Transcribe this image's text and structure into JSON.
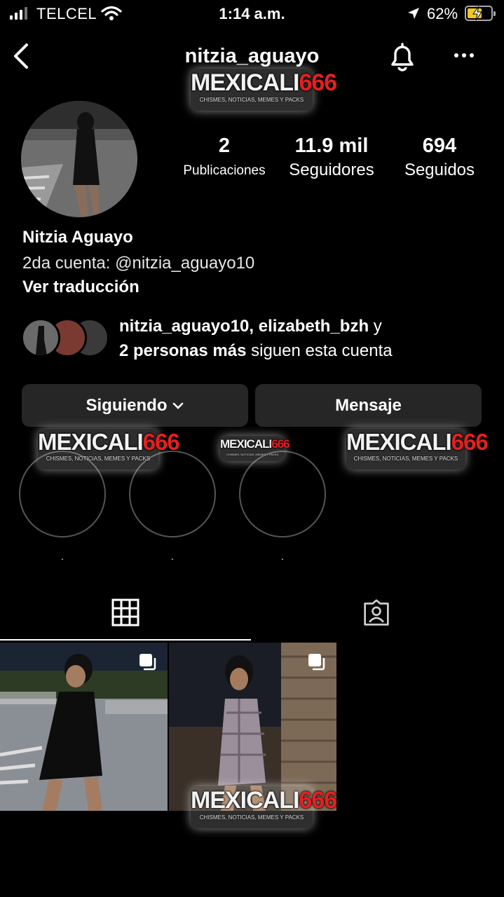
{
  "status_bar": {
    "carrier": "TELCEL",
    "time": "1:14 a.m.",
    "battery_pct": "62%",
    "battery_level": 0.62
  },
  "header": {
    "username": "nitzia_aguayo",
    "icons": [
      "back-chevron-icon",
      "bell-icon",
      "more-icon"
    ]
  },
  "watermark": {
    "brand": "MEXICALI",
    "brand_num": "666",
    "tagline": "CHISMES, NOTICIAS, MEMES Y PACKS"
  },
  "profile": {
    "stats": [
      {
        "value": "2",
        "label": "Publicaciones"
      },
      {
        "value": "11.9 mil",
        "label": "Seguidores"
      },
      {
        "value": "694",
        "label": "Seguidos"
      }
    ],
    "name": "Nitzia Aguayo",
    "bio": "2da cuenta: @nitzia_aguayo10",
    "translate": "Ver traducción",
    "followed_by": {
      "accounts": "nitzia_aguayo10, elizabeth_bzh",
      "conj": " y",
      "more": "2 personas más",
      "suffix": " siguen esta cuenta"
    }
  },
  "actions": {
    "following": "Siguiendo",
    "message": "Mensaje"
  },
  "highlights": [
    {
      "label": "."
    },
    {
      "label": "."
    },
    {
      "label": "."
    }
  ],
  "tabs": [
    "grid-icon",
    "tagged-icon"
  ],
  "posts": [
    {
      "type": "multi-photo"
    },
    {
      "type": "multi-photo"
    }
  ],
  "colors": {
    "background": "#000000",
    "button": "#262626",
    "battery": "#f3c623",
    "brand_red": "#e52020"
  }
}
